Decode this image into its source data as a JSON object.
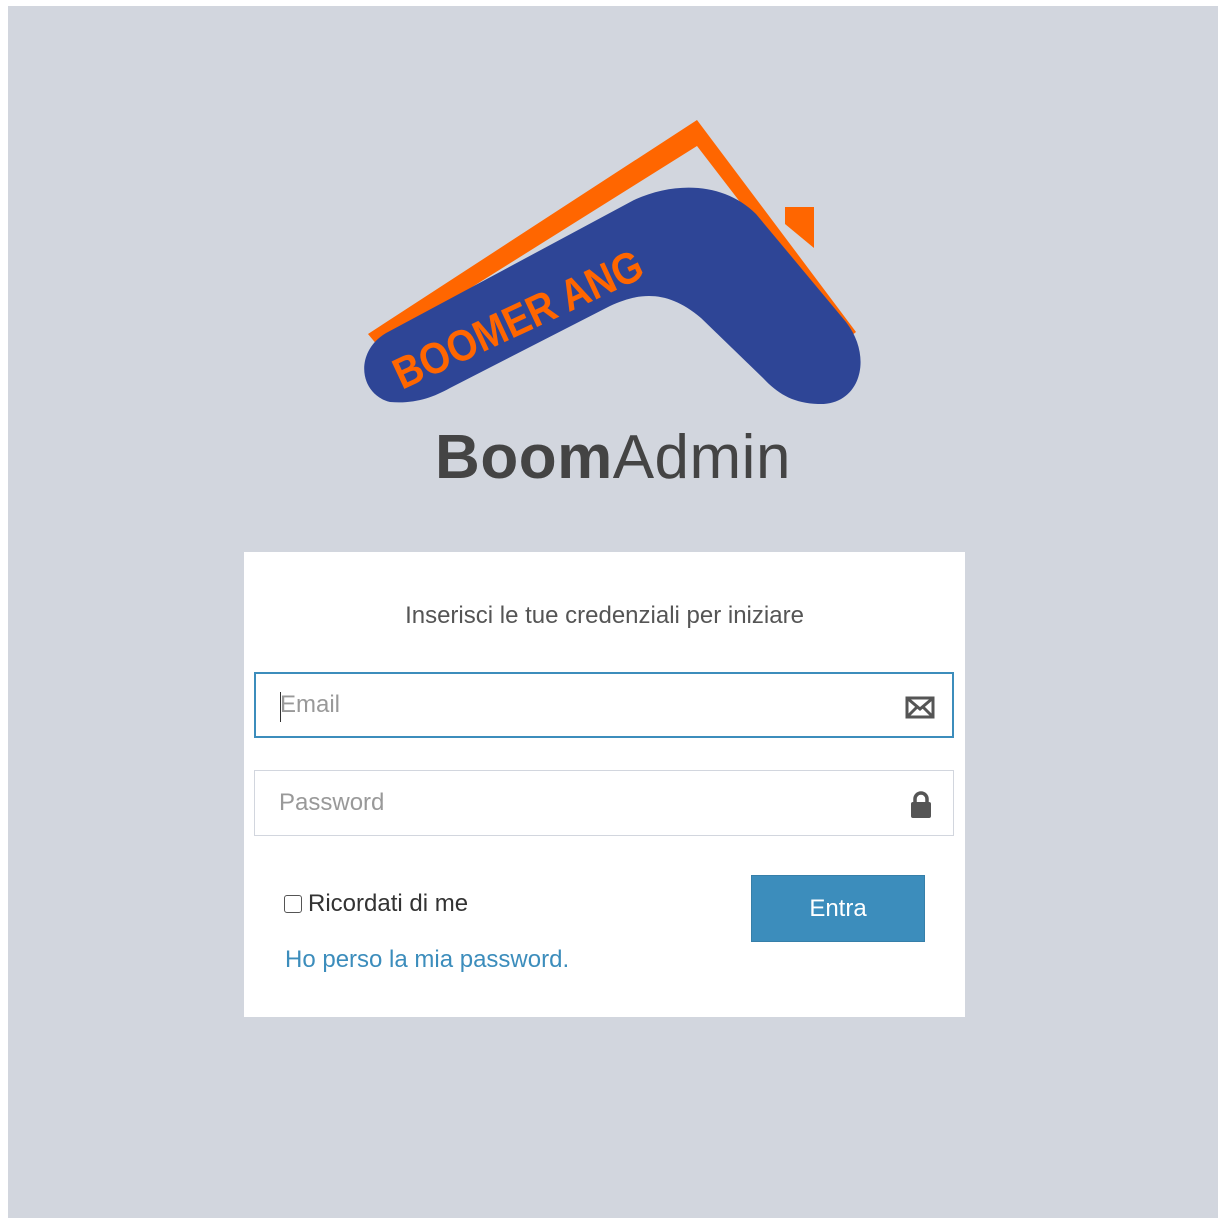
{
  "logo": {
    "wordmark_text": "BOOMERANG",
    "colors": {
      "roof": "#ff6600",
      "boomerang": "#2e4596",
      "wordmark": "#ff6600"
    }
  },
  "brand": {
    "bold": "Boom",
    "light": "Admin"
  },
  "login": {
    "message": "Inserisci le tue credenziali per iniziare",
    "email": {
      "placeholder": "Email",
      "value": "",
      "icon": "envelope-icon"
    },
    "password": {
      "placeholder": "Password",
      "value": "",
      "icon": "lock-icon"
    },
    "remember_label": "Ricordati di me",
    "remember_checked": false,
    "submit_label": "Entra",
    "forgot_label": "Ho perso la mia password."
  },
  "colors": {
    "background": "#d2d6de",
    "accent": "#3c8dbc",
    "box": "#ffffff"
  }
}
